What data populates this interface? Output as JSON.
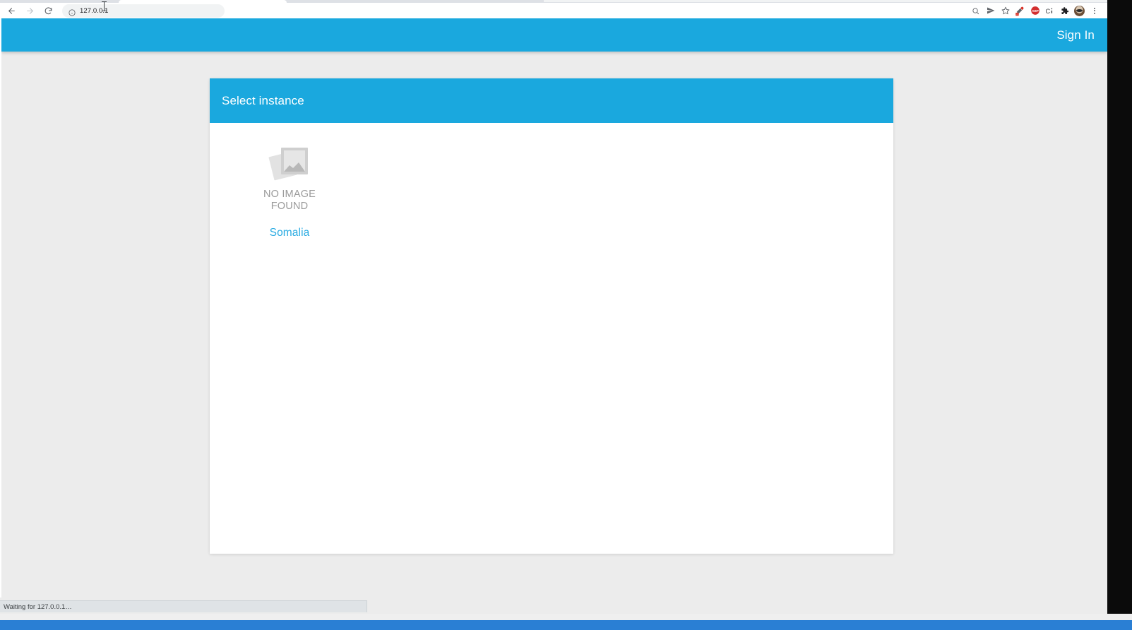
{
  "browser": {
    "back_icon": "back-arrow-icon",
    "forward_icon": "forward-arrow-icon",
    "reload_icon": "reload-icon",
    "site_info_icon": "info-circle-icon",
    "url": "127.0.0.1",
    "toolbar_icons": [
      {
        "name": "zoom-magnifier-icon",
        "glyph": "⊕"
      },
      {
        "name": "send-share-icon",
        "glyph": "➤"
      },
      {
        "name": "bookmark-star-icon",
        "glyph": "☆"
      },
      {
        "name": "color-picker-extension-icon",
        "glyph": ""
      },
      {
        "name": "adblock-extension-icon",
        "glyph": "ABP"
      },
      {
        "name": "clipboard-extension-icon",
        "glyph": "C"
      },
      {
        "name": "extensions-puzzle-icon",
        "glyph": "✦"
      },
      {
        "name": "profile-avatar-icon",
        "glyph": ""
      },
      {
        "name": "browser-menu-icon",
        "glyph": "⋮"
      }
    ]
  },
  "site": {
    "navbar": {
      "signin_label": "Sign In"
    },
    "card": {
      "title": "Select instance",
      "instances": [
        {
          "placeholder_icon": "no-image-placeholder-icon",
          "placeholder_text": "NO IMAGE\nFOUND",
          "name": "Somalia"
        }
      ]
    }
  },
  "status": {
    "text": "Waiting for 127.0.0.1…"
  },
  "colors": {
    "brand_blue": "#1aa8de",
    "link_blue": "#29abe2",
    "page_background": "#ececec",
    "card_background": "#ffffff",
    "placeholder_gray": "#9a9a9a",
    "taskbar_blue": "#2a7fd4"
  }
}
